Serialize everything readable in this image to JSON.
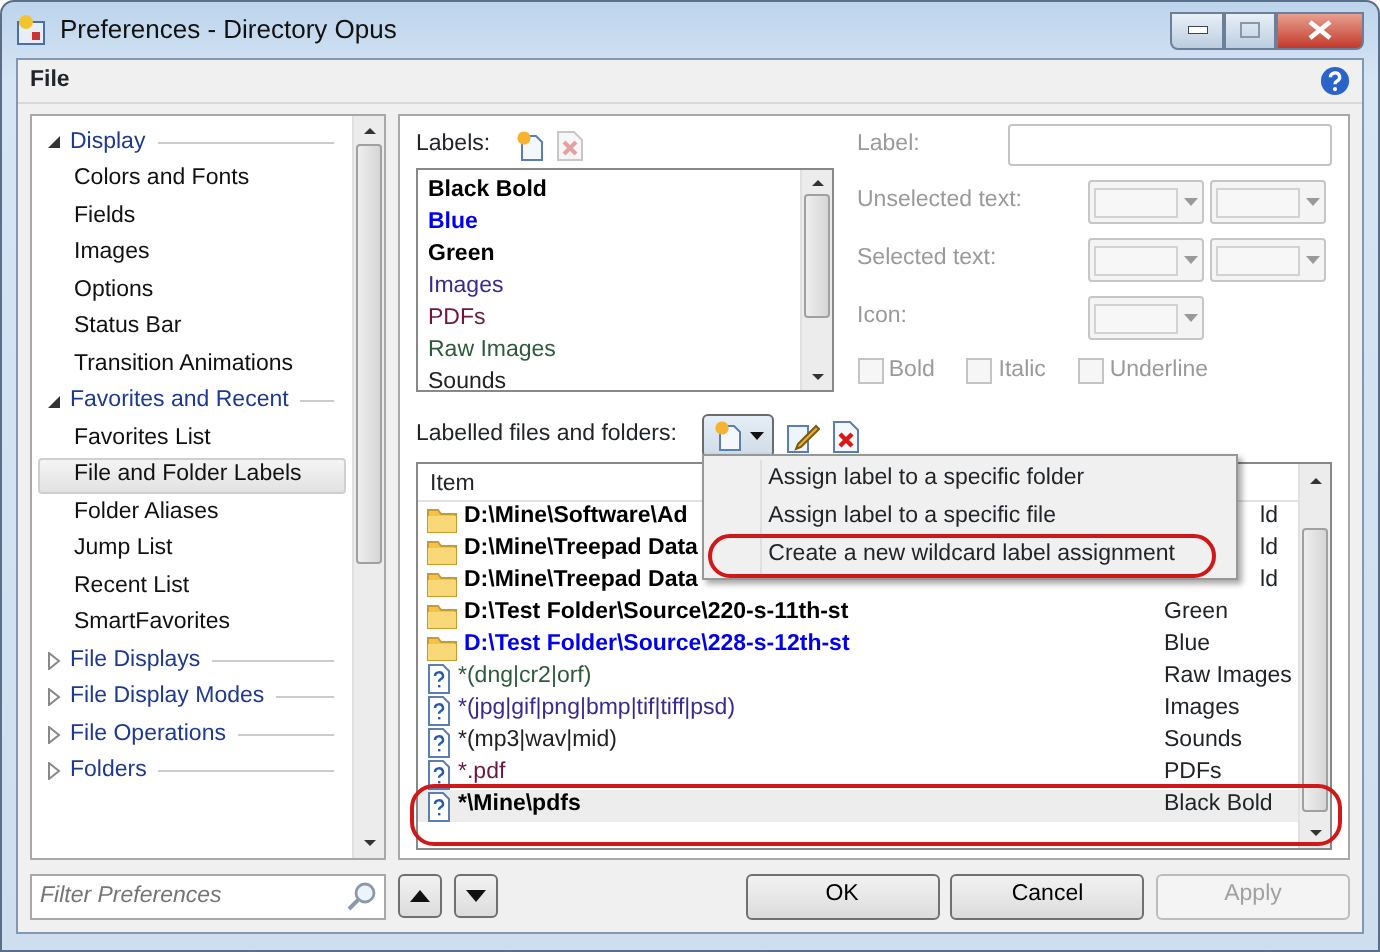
{
  "window": {
    "title": "Preferences - Directory Opus"
  },
  "menu": [
    {
      "label": "File"
    }
  ],
  "sidebar": {
    "sections": [
      {
        "label": "Display",
        "expanded": true,
        "children": [
          {
            "label": "Colors and Fonts",
            "selected": false
          },
          {
            "label": "Fields",
            "selected": false
          },
          {
            "label": "Images",
            "selected": false
          },
          {
            "label": "Options",
            "selected": false
          },
          {
            "label": "Status Bar",
            "selected": false
          },
          {
            "label": "Transition Animations",
            "selected": false
          }
        ]
      },
      {
        "label": "Favorites and Recent",
        "expanded": true,
        "children": [
          {
            "label": "Favorites List",
            "selected": false
          },
          {
            "label": "File and Folder Labels",
            "selected": true
          },
          {
            "label": "Folder Aliases",
            "selected": false
          },
          {
            "label": "Jump List",
            "selected": false
          },
          {
            "label": "Recent List",
            "selected": false
          },
          {
            "label": "SmartFavorites",
            "selected": false
          }
        ]
      },
      {
        "label": "File Displays",
        "expanded": false
      },
      {
        "label": "File Display Modes",
        "expanded": false
      },
      {
        "label": "File Operations",
        "expanded": false
      },
      {
        "label": "Folders",
        "expanded": false
      }
    ]
  },
  "filter": {
    "placeholder": "Filter Preferences"
  },
  "labels": {
    "heading": "Labels:",
    "items": [
      {
        "name": "Black Bold",
        "color": "#000000",
        "bold": true
      },
      {
        "name": "Blue",
        "color": "#0000ee",
        "bold": true
      },
      {
        "name": "Green",
        "color": "#000000",
        "bold": true
      },
      {
        "name": "Images",
        "color": "#3b2a8c",
        "bold": false
      },
      {
        "name": "PDFs",
        "color": "#6b1840",
        "bold": false
      },
      {
        "name": "Raw Images",
        "color": "#2f5a3a",
        "bold": false
      },
      {
        "name": "Sounds",
        "color": "#222222",
        "bold": false
      }
    ]
  },
  "label_editor": {
    "disabled": true,
    "label_caption": "Label:",
    "unselected_caption": "Unselected text:",
    "selected_caption": "Selected text:",
    "icon_caption": "Icon:",
    "checkboxes": [
      {
        "label": "Bold",
        "checked": false
      },
      {
        "label": "Italic",
        "checked": false
      },
      {
        "label": "Underline",
        "checked": false
      }
    ]
  },
  "assignments": {
    "heading": "Labelled files and folders:",
    "menu_open": true,
    "columns": [
      "Item"
    ],
    "rows": [
      {
        "kind": "folder",
        "item": "D:\\Mine\\Software\\Ad",
        "label": "ld",
        "color": "#000000",
        "bold": true,
        "selected": false,
        "circled": false,
        "covered": true
      },
      {
        "kind": "folder",
        "item": "D:\\Mine\\Treepad Data",
        "label": "ld",
        "color": "#000000",
        "bold": true,
        "selected": false,
        "circled": false,
        "covered": true
      },
      {
        "kind": "folder",
        "item": "D:\\Mine\\Treepad Data",
        "label": "ld",
        "color": "#000000",
        "bold": true,
        "selected": false,
        "circled": false,
        "covered": true
      },
      {
        "kind": "folder",
        "item": "D:\\Test Folder\\Source\\220-s-11th-st",
        "label": "Green",
        "color": "#000000",
        "bold": true,
        "selected": false,
        "circled": false,
        "covered": false
      },
      {
        "kind": "folder",
        "item": "D:\\Test Folder\\Source\\228-s-12th-st",
        "label": "Blue",
        "color": "#0000ee",
        "bold": true,
        "selected": false,
        "circled": false,
        "covered": false
      },
      {
        "kind": "wildcard",
        "item": "*(dng|cr2|orf)",
        "label": "Raw Images",
        "color": "#2f5a3a",
        "bold": false,
        "selected": false,
        "circled": false,
        "covered": false
      },
      {
        "kind": "wildcard",
        "item": "*(jpg|gif|png|bmp|tif|tiff|psd)",
        "label": "Images",
        "color": "#3b2a8c",
        "bold": false,
        "selected": false,
        "circled": false,
        "covered": false
      },
      {
        "kind": "wildcard",
        "item": "*(mp3|wav|mid)",
        "label": "Sounds",
        "color": "#222222",
        "bold": false,
        "selected": false,
        "circled": false,
        "covered": false
      },
      {
        "kind": "wildcard",
        "item": "*.pdf",
        "label": "PDFs",
        "color": "#6b1840",
        "bold": false,
        "selected": false,
        "circled": false,
        "covered": false
      },
      {
        "kind": "wildcard",
        "item": "*\\Mine\\pdfs",
        "label": "Black Bold",
        "color": "#000000",
        "bold": true,
        "selected": true,
        "circled": true,
        "covered": false
      }
    ]
  },
  "dropdown_menu": [
    {
      "label": "Assign label to a specific folder",
      "circled": false
    },
    {
      "label": "Assign label to a specific file",
      "circled": false
    },
    {
      "label": "Create a new wildcard label assignment",
      "circled": true
    }
  ],
  "buttons": [
    {
      "label": "OK",
      "disabled": false
    },
    {
      "label": "Cancel",
      "disabled": false
    },
    {
      "label": "Apply",
      "disabled": true
    }
  ]
}
